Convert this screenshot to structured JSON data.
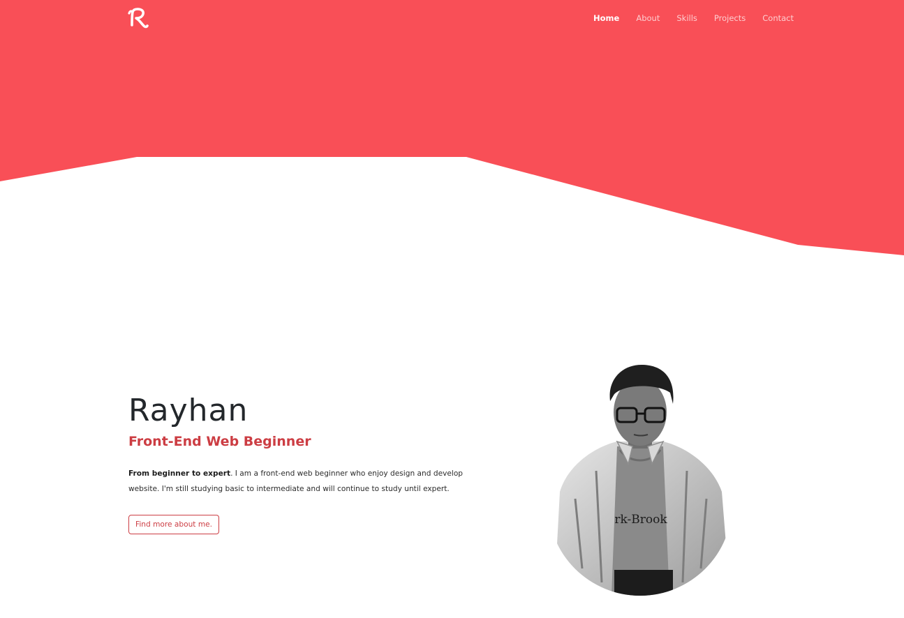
{
  "brand": {
    "logo_icon": "script-r-logo-icon",
    "accent_color": "#f94f57",
    "heading_accent": "#cc3d43"
  },
  "nav": {
    "items": [
      {
        "label": "Home",
        "active": true
      },
      {
        "label": "About",
        "active": false
      },
      {
        "label": "Skills",
        "active": false
      },
      {
        "label": "Projects",
        "active": false
      },
      {
        "label": "Contact",
        "active": false
      }
    ]
  },
  "hero": {
    "name": "Rayhan",
    "role": "Front-End Web Beginner",
    "intro_bold": "From beginner to expert",
    "intro_rest": ". I am a front-end web beginner who enjoy design and develop website. I'm still studying basic to intermediate and will continue to study until expert.",
    "cta_label": "Find more about me.",
    "photo_icon": "profile-photo"
  }
}
